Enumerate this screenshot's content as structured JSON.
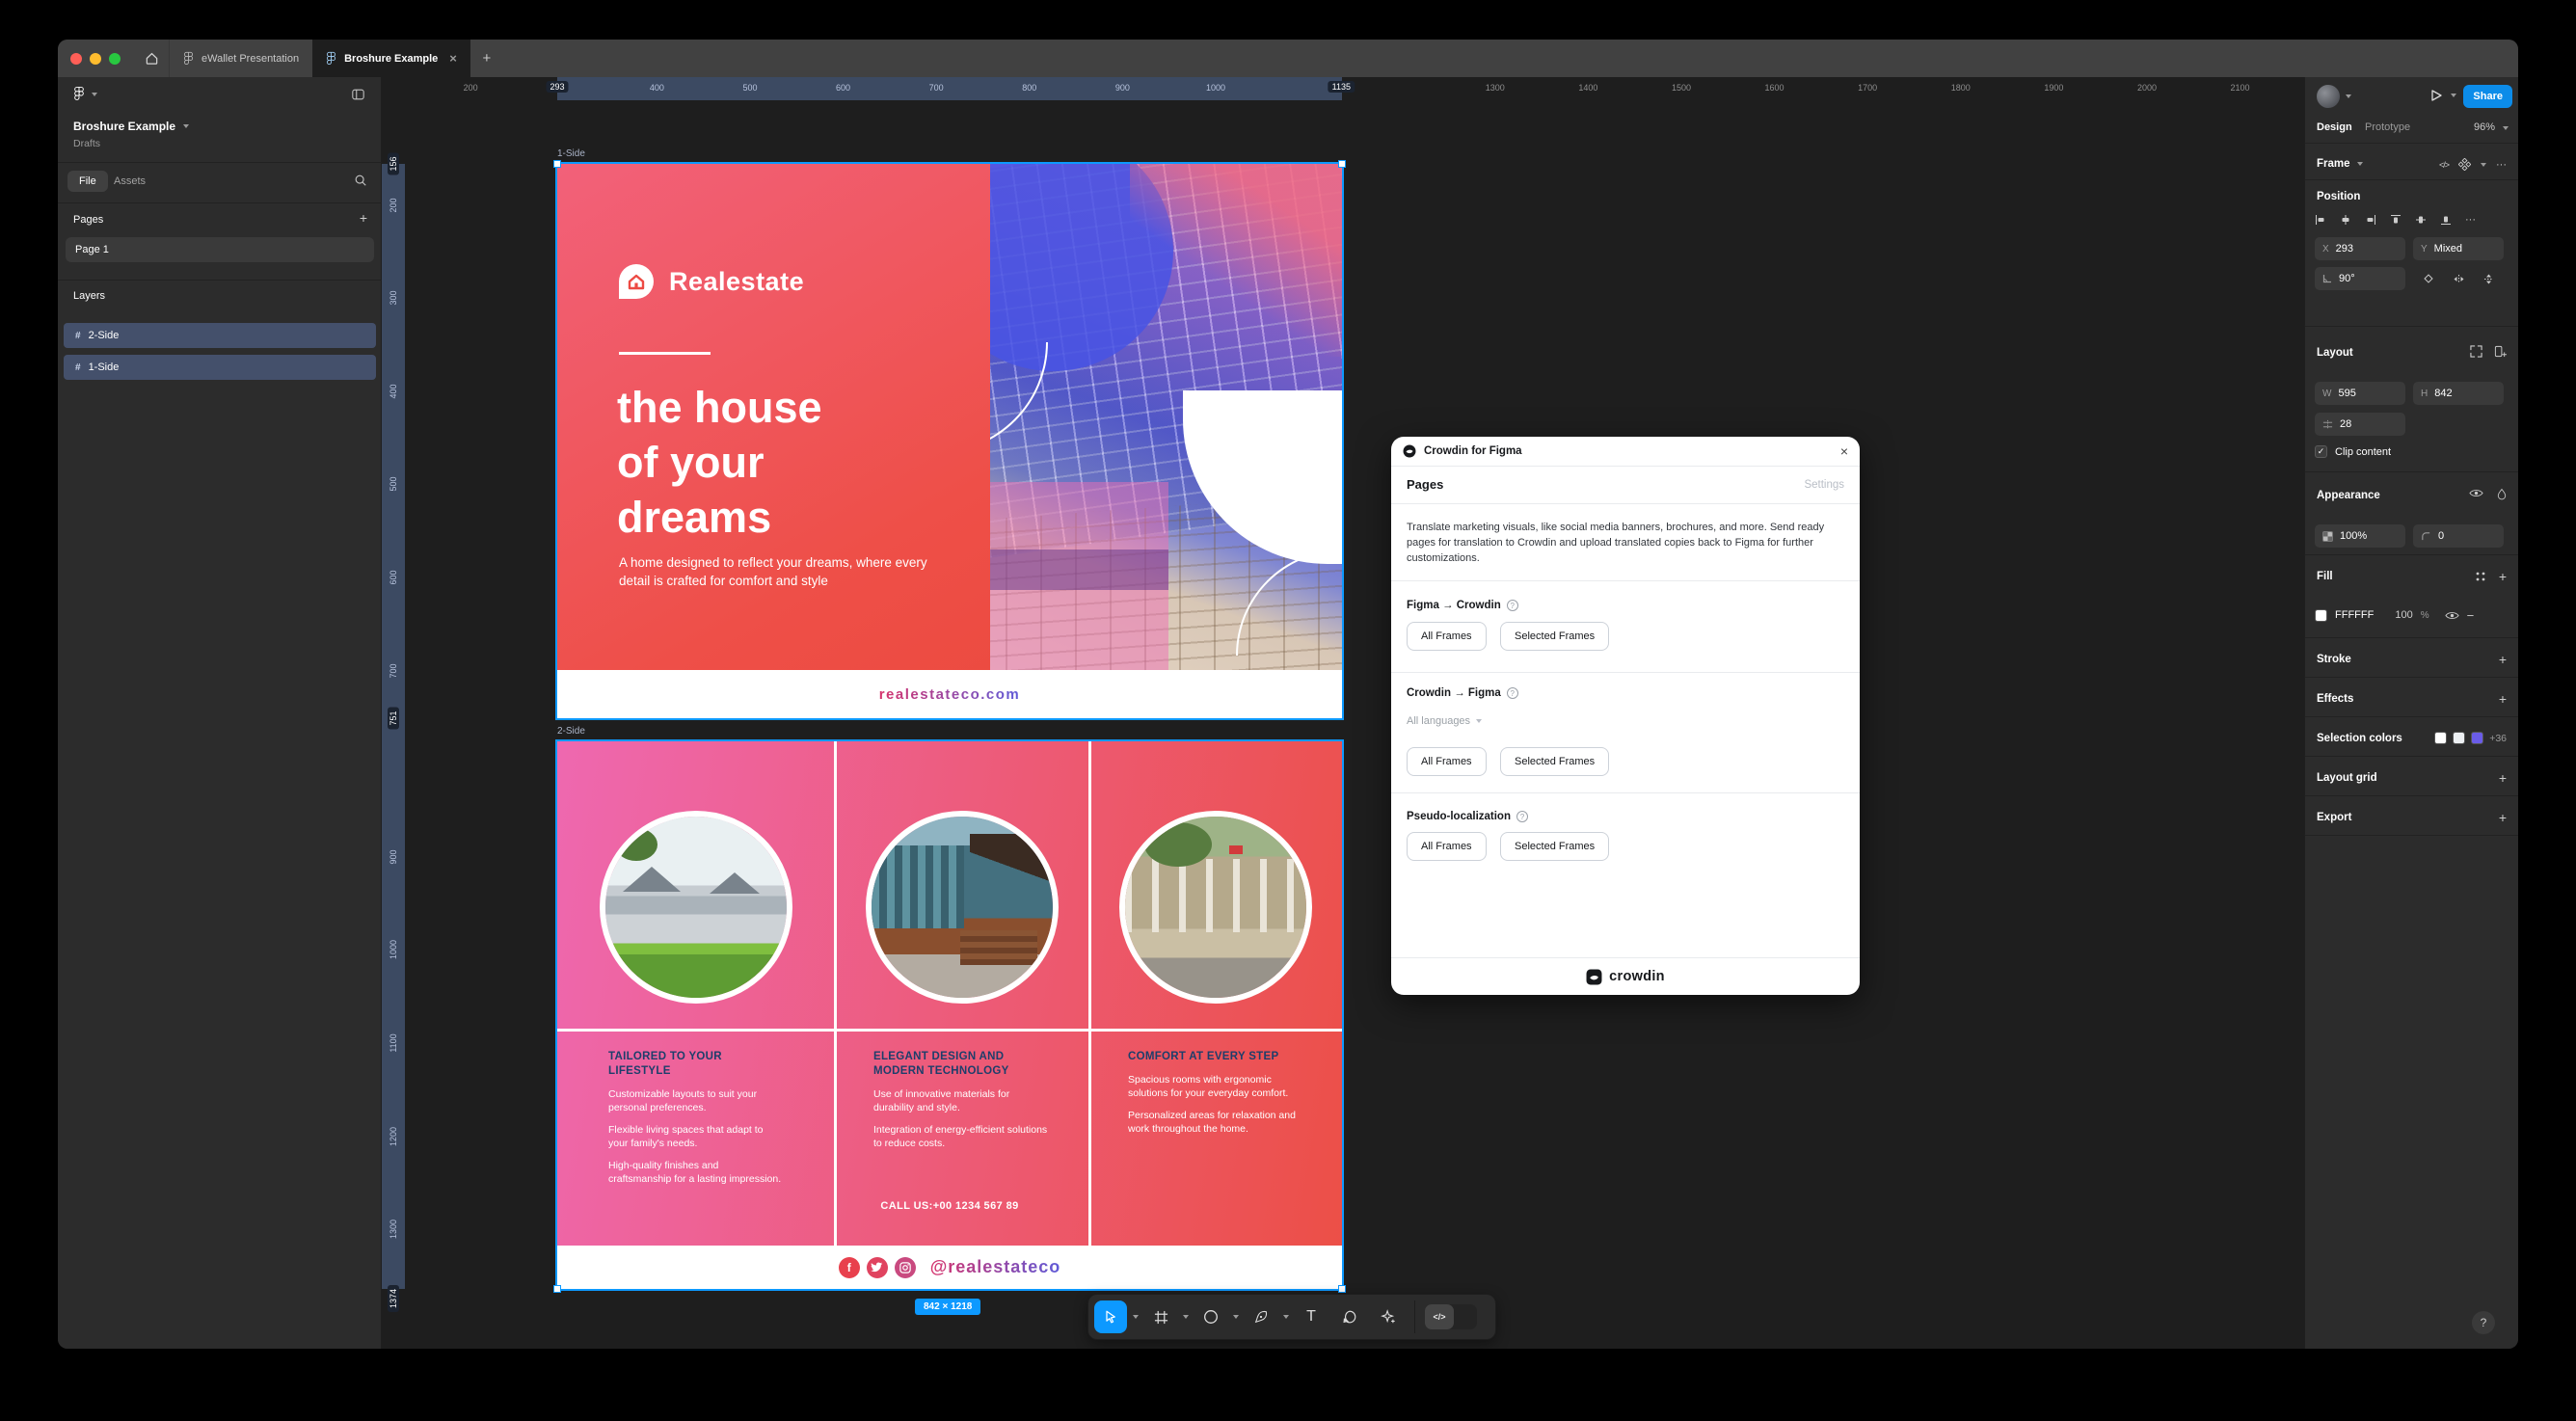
{
  "window": {
    "tabs": [
      {
        "label": "eWallet Presentation",
        "active": false
      },
      {
        "label": "Broshure Example",
        "active": true
      }
    ],
    "close_glyph": "×",
    "new_tab_glyph": "+"
  },
  "sidebar": {
    "file_name": "Broshure Example",
    "location": "Drafts",
    "tab_file": "File",
    "tab_assets": "Assets",
    "pages_header": "Pages",
    "page_item": "Page 1",
    "layers_header": "Layers",
    "layers": [
      {
        "label": "2-Side"
      },
      {
        "label": "1-Side"
      }
    ]
  },
  "canvas": {
    "ruler_h": [
      "200",
      "293",
      "400",
      "500",
      "600",
      "700",
      "800",
      "900",
      "1000",
      "1135",
      "1300",
      "1400",
      "1500",
      "1600",
      "1700",
      "1800",
      "1900",
      "2000",
      "2100"
    ],
    "ruler_h_chips": [
      "293",
      "1135"
    ],
    "ruler_v": [
      "156",
      "200",
      "300",
      "400",
      "500",
      "600",
      "700",
      "751",
      "900",
      "1000",
      "1100",
      "1200",
      "1300",
      "1374"
    ],
    "ruler_v_chips": [
      "156",
      "751",
      "1374"
    ],
    "frame1_label": "1-Side",
    "frame2_label": "2-Side",
    "size_badge": "842 × 1218"
  },
  "brochure1": {
    "brand": "Realestate",
    "heading_lines": [
      "the house",
      "of your",
      "dreams"
    ],
    "subtext": "A home designed to reflect your dreams, where every detail is crafted for comfort and style",
    "website": "realestateco.com"
  },
  "brochure2": {
    "columns": [
      {
        "heading": "TAILORED TO YOUR LIFESTYLE",
        "paragraphs": [
          "Customizable layouts to suit your personal preferences.",
          "Flexible living spaces that adapt to your family's needs.",
          "High-quality finishes and craftsmanship for a lasting impression."
        ]
      },
      {
        "heading": "ELEGANT DESIGN AND MODERN TECHNOLOGY",
        "paragraphs": [
          "Use of innovative materials for durability and style.",
          "Integration of energy-efficient solutions to reduce costs."
        ]
      },
      {
        "heading": "COMFORT AT EVERY STEP",
        "paragraphs": [
          "Spacious rooms with ergonomic solutions for your everyday comfort.",
          "Personalized areas for relaxation and work throughout the home."
        ]
      }
    ],
    "call_us": "CALL US:+00 1234 567 89",
    "social_handle": "@realestateco"
  },
  "dialog": {
    "title": "Crowdin for Figma",
    "close_glyph": "×",
    "page_heading": "Pages",
    "settings": "Settings",
    "description": "Translate marketing visuals, like social media banners, brochures, and more. Send ready pages for translation to Crowdin and upload translated copies back to Figma for further customizations.",
    "sections": [
      {
        "label": "Figma → Crowdin",
        "buttons": [
          "All Frames",
          "Selected Frames"
        ]
      },
      {
        "label": "Crowdin → Figma",
        "dropdown": "All languages",
        "buttons": [
          "All Frames",
          "Selected Frames"
        ]
      },
      {
        "label": "Pseudo-localization",
        "buttons": [
          "All Frames",
          "Selected Frames"
        ]
      }
    ],
    "help_glyph": "?",
    "footer_logo": "crowdin"
  },
  "panel": {
    "share": "Share",
    "tab_design": "Design",
    "tab_prototype": "Prototype",
    "zoom": "96%",
    "selection_type": "Frame",
    "more_glyph": "···",
    "position": {
      "header": "Position",
      "x_label": "X",
      "x": "293",
      "y_label": "Y",
      "y": "Mixed",
      "rotation": "90°"
    },
    "layout": {
      "header": "Layout",
      "w_label": "W",
      "w": "595",
      "h_label": "H",
      "h": "842",
      "gap": "28",
      "clip": "Clip content",
      "check": "✓"
    },
    "appearance": {
      "header": "Appearance",
      "opacity": "100%",
      "radius": "0"
    },
    "fill": {
      "header": "Fill",
      "hex": "FFFFFF",
      "opacity": "100",
      "percent": "%",
      "minus": "−"
    },
    "stroke": {
      "header": "Stroke"
    },
    "effects": {
      "header": "Effects"
    },
    "selection_colors": {
      "header": "Selection colors",
      "more": "+36",
      "swatches": [
        "#ffffff",
        "#edf0f3",
        "#6a5ce8"
      ]
    },
    "layout_grid": {
      "header": "Layout grid"
    },
    "export": {
      "header": "Export"
    },
    "help": "?",
    "dev_glyph": "</>"
  },
  "colors": {
    "accent": "#0d99ff",
    "brochure_red": "#ed4f48",
    "brochure_pink": "#ee68b0",
    "brochure_purple": "#5c5fd8",
    "social": [
      "#e8404d",
      "#e0435f",
      "#c9497f"
    ]
  }
}
